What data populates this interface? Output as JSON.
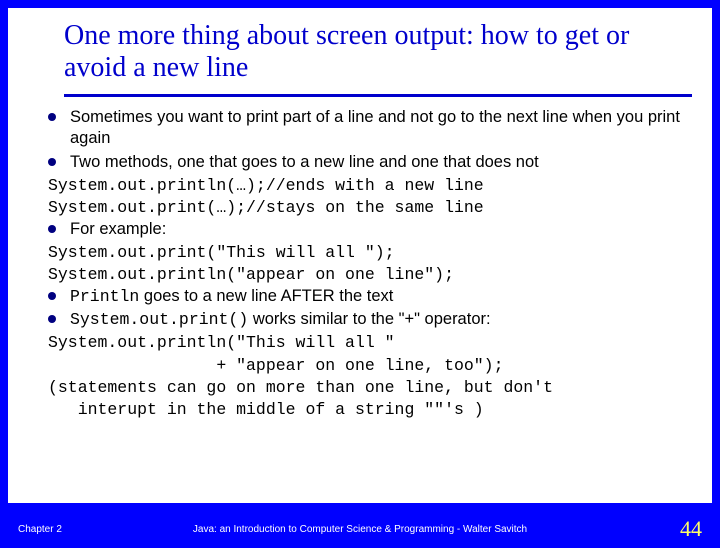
{
  "title": "One more thing about screen output: how to get or avoid a new line",
  "bullets": {
    "b1": "Sometimes you want to print part of a line and not go to the next line when you print again",
    "b2": "Two methods, one that goes to a new line and one that does not",
    "b3": "For example:",
    "b4_pre": "Println",
    "b4_post": " goes to a new line AFTER the text",
    "b5_pre": "System.out.print()",
    "b5_post": " works similar to the \"+\" operator:"
  },
  "code": {
    "c1": "System.out.println(…);//ends with a new line",
    "c2": "System.out.print(…);//stays on the same line",
    "c3": "System.out.print(\"This will all \");",
    "c4": "System.out.println(\"appear on one line\");",
    "c5": "System.out.println(\"This will all \"",
    "c6": "                 + \"appear on one line, too\");",
    "c7": "(statements can go on more than one line, but don't",
    "c8": "   interupt in the middle of a string \"\"'s )"
  },
  "footer": {
    "left": "Chapter 2",
    "center": "Java: an Introduction to Computer Science & Programming - Walter Savitch",
    "page": "44"
  }
}
